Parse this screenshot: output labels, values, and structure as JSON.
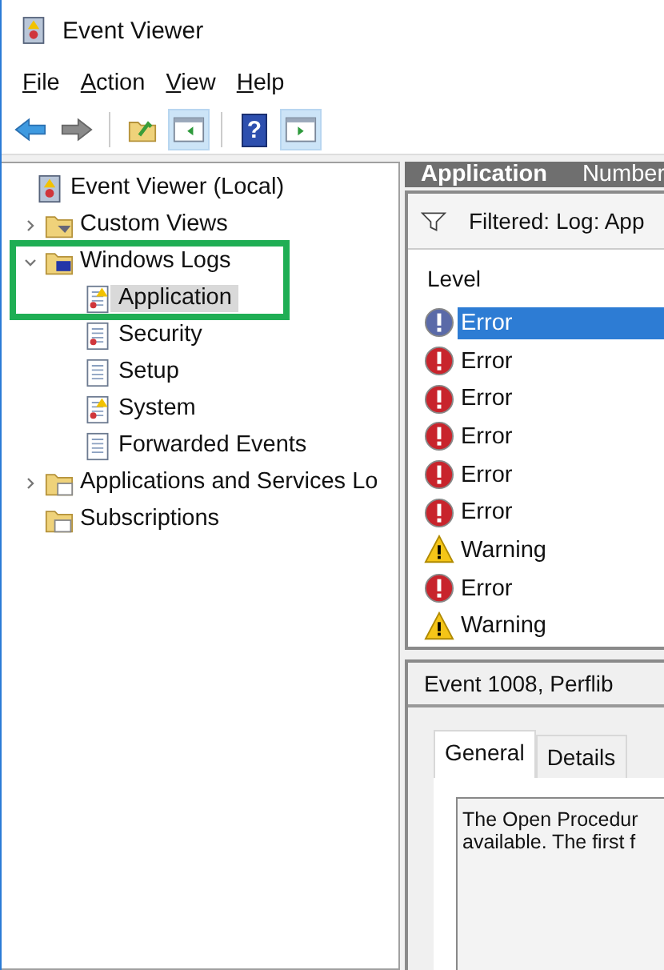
{
  "window": {
    "title": "Event Viewer"
  },
  "menu": [
    "File",
    "Action",
    "View",
    "Help"
  ],
  "toolbar": [
    {
      "kind": "back",
      "selected": false
    },
    {
      "kind": "forward",
      "selected": false
    },
    {
      "kind": "sep"
    },
    {
      "kind": "up-folder",
      "selected": false
    },
    {
      "kind": "show-tree",
      "selected": true
    },
    {
      "kind": "sep"
    },
    {
      "kind": "help",
      "selected": false,
      "glyph": "?"
    },
    {
      "kind": "show-actions",
      "selected": true
    }
  ],
  "tree": [
    {
      "label": "Event Viewer (Local)",
      "kind": "root",
      "selected": false,
      "children": [
        {
          "label": "Custom Views",
          "kind": "filter-folder",
          "expanded": false,
          "selected": false
        },
        {
          "label": "Windows Logs",
          "kind": "logs-folder",
          "expanded": true,
          "selected": false,
          "children": [
            {
              "label": "Application",
              "kind": "warning-log",
              "selected": true
            },
            {
              "label": "Security",
              "kind": "error-log",
              "selected": false
            },
            {
              "label": "Setup",
              "kind": "log",
              "selected": false
            },
            {
              "label": "System",
              "kind": "warning-log",
              "selected": false
            },
            {
              "label": "Forwarded Events",
              "kind": "log",
              "selected": false
            }
          ]
        },
        {
          "label": "Applications and Services Lo",
          "kind": "folder",
          "expanded": false,
          "selected": false
        },
        {
          "label": "Subscriptions",
          "kind": "subscriptions",
          "selected": false
        }
      ]
    }
  ],
  "log_header": {
    "title": "Application",
    "column_2": "Number"
  },
  "filter": {
    "text": "Filtered: Log: App"
  },
  "events": {
    "column": "Level",
    "rows": [
      {
        "level": "Error",
        "kind": "error",
        "selected": true
      },
      {
        "level": "Error",
        "kind": "error",
        "selected": false
      },
      {
        "level": "Error",
        "kind": "error",
        "selected": false
      },
      {
        "level": "Error",
        "kind": "error",
        "selected": false
      },
      {
        "level": "Error",
        "kind": "error",
        "selected": false
      },
      {
        "level": "Error",
        "kind": "error",
        "selected": false
      },
      {
        "level": "Warning",
        "kind": "warning",
        "selected": false
      },
      {
        "level": "Error",
        "kind": "error",
        "selected": false
      },
      {
        "level": "Warning",
        "kind": "warning",
        "selected": false
      }
    ]
  },
  "detail": {
    "title": "Event 1008, Perflib",
    "tabs": [
      {
        "label": "General",
        "selected": true
      },
      {
        "label": "Details",
        "selected": false
      }
    ],
    "lines": [
      "The Open Procedur",
      "available. The first f"
    ]
  }
}
